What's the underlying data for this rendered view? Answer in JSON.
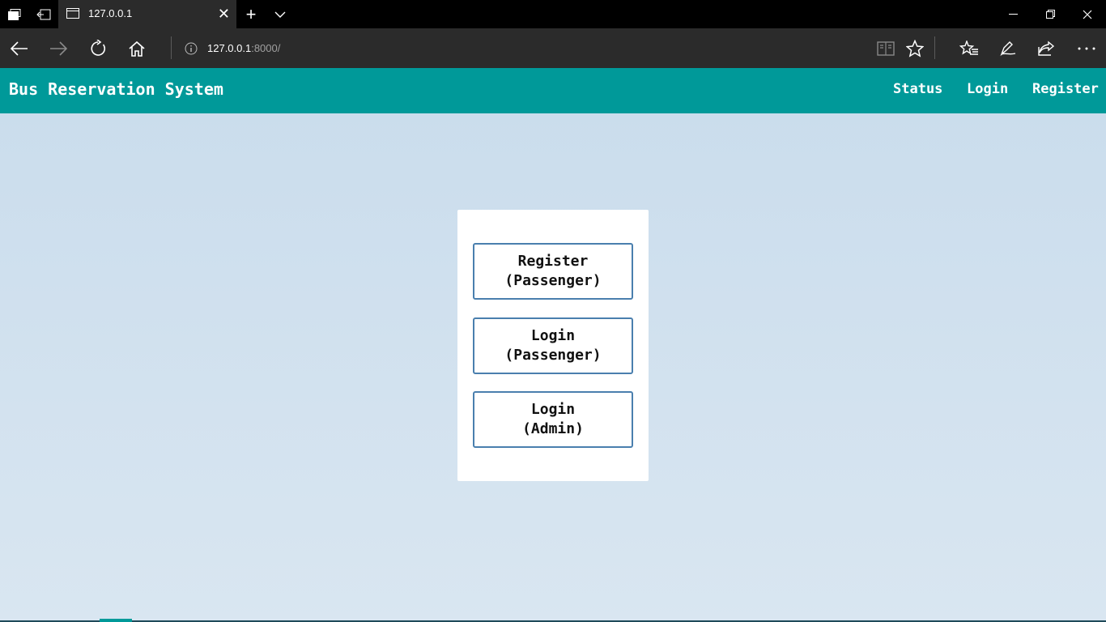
{
  "browser": {
    "tab_title": "127.0.0.1",
    "address_host": "127.0.0.1",
    "address_port_path": ":8000/"
  },
  "app": {
    "brand": "Bus Reservation System",
    "nav": {
      "status": "Status",
      "login": "Login",
      "register": "Register"
    },
    "colors": {
      "header": "#009999",
      "button_border": "#4a7fae"
    }
  },
  "card": {
    "buttons": [
      {
        "line1": "Register",
        "line2": "(Passenger)"
      },
      {
        "line1": "Login",
        "line2": "(Passenger)"
      },
      {
        "line1": "Login",
        "line2": "(Admin)"
      }
    ]
  }
}
